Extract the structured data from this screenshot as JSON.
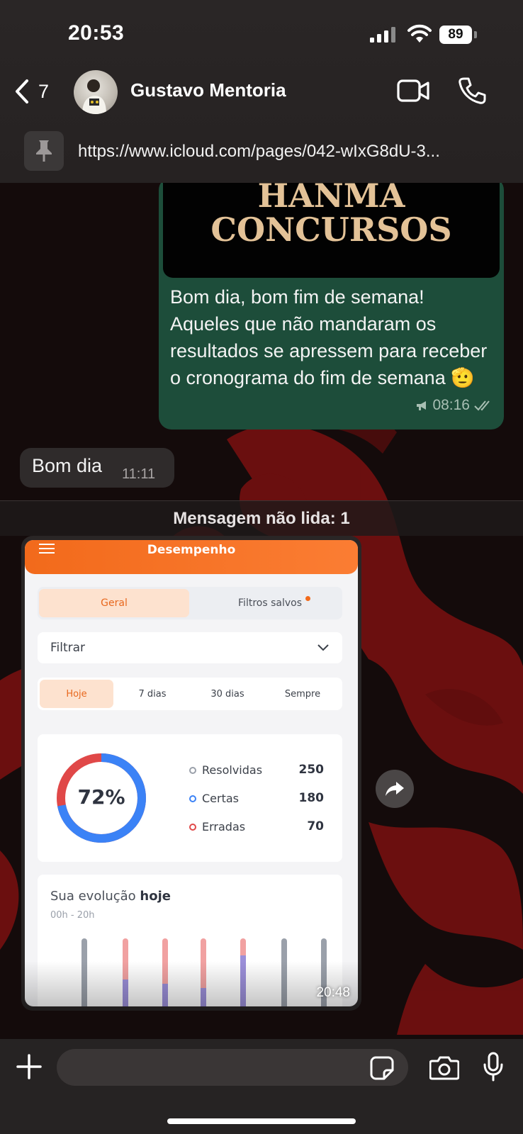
{
  "status_bar": {
    "time": "20:53",
    "battery": "89"
  },
  "header": {
    "back_count": "7",
    "contact_name": "Gustavo Mentoria"
  },
  "pinned": {
    "url": "https://www.icloud.com/pages/042-wIxG8dU-3..."
  },
  "messages": {
    "outgoing": {
      "poster_line1": "HANMA",
      "poster_line2": "CONCURSOS",
      "text": "Bom dia, bom fim de semana! Aqueles que não mandaram os resultados se apressem para receber o cronograma do fim de semana 🫡",
      "time": "08:16"
    },
    "incoming": {
      "text": "Bom dia",
      "time": "11:11"
    },
    "unread_label": "Mensagem não lida: 1",
    "image": {
      "time": "20:48",
      "screen": {
        "title": "Desempenho",
        "tabs": [
          "Geral",
          "Filtros salvos"
        ],
        "filter_label": "Filtrar",
        "periods": [
          "Hoje",
          "7 dias",
          "30 dias",
          "Sempre"
        ],
        "percent": "72%",
        "stats": [
          {
            "label": "Resolvidas",
            "value": "250",
            "color": "#9aa0aa"
          },
          {
            "label": "Certas",
            "value": "180",
            "color": "#3b82f6"
          },
          {
            "label": "Erradas",
            "value": "70",
            "color": "#e04848"
          }
        ],
        "evolution_prefix": "Sua evolução ",
        "evolution_bold": "hoje",
        "evolution_range": "00h - 20h"
      }
    }
  },
  "composer": {
    "placeholder": ""
  },
  "colors": {
    "accent_orange": "#f26a1b",
    "bubble_out": "#1d4d3a",
    "bubble_in": "#2f2b2b"
  }
}
